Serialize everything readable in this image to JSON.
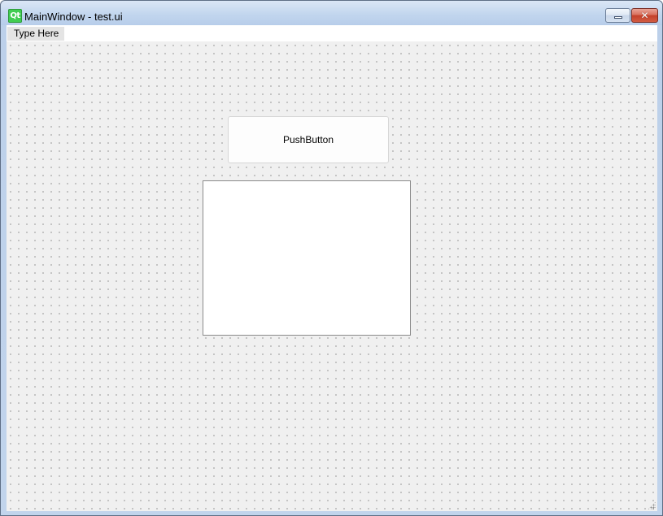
{
  "window": {
    "title": "MainWindow - test.ui",
    "logo_text": "Qt",
    "minimize_icon": "minimize-icon",
    "close_icon": "close-icon",
    "close_glyph": "✕"
  },
  "menubar": {
    "placeholder_item": "Type Here"
  },
  "form": {
    "push_button_label": "PushButton"
  },
  "colors": {
    "qt_green": "#41cd52",
    "close_red": "#c3402b",
    "canvas_bg": "#f0f0f0"
  }
}
